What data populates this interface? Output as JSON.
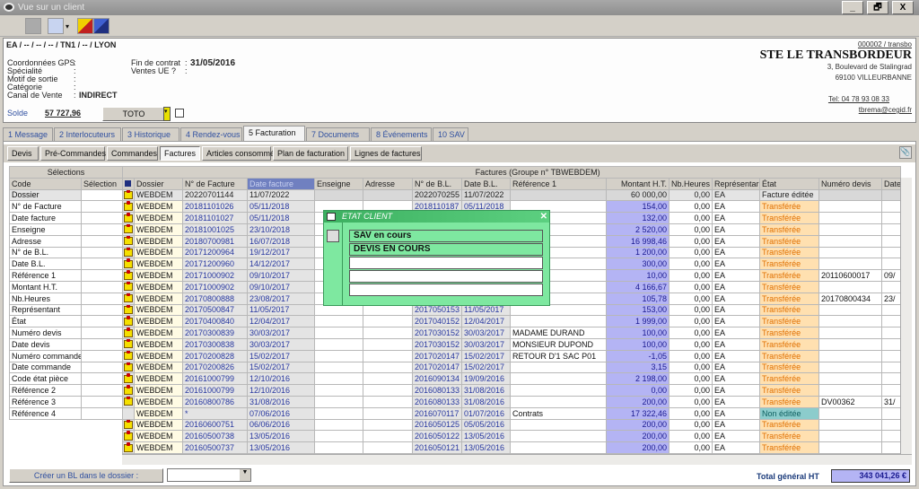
{
  "window": {
    "title": "Vue sur un client",
    "min": "_",
    "restore": "🗗",
    "close": "X"
  },
  "header": {
    "path": "EA / -- / -- / -- / TN1 / -- / LYON",
    "fields": [
      {
        "label": "Coordonnées GPS",
        "value": ""
      },
      {
        "label": "Spécialité",
        "value": ""
      },
      {
        "label": "Motif de sortie",
        "value": ""
      },
      {
        "label": "Catégorie",
        "value": ""
      },
      {
        "label": "Canal de Vente",
        "value": "INDIRECT"
      }
    ],
    "fields2": [
      {
        "label": "Fin de contrat",
        "value": "31/05/2016"
      },
      {
        "label": "Ventes UE ?",
        "value": ""
      }
    ],
    "solde_label": "Solde",
    "solde_value": "57 727,96",
    "combo_value": "TOTO",
    "company": {
      "code": "000002 / transbo",
      "name": "STE LE TRANSBORDEUR",
      "address1": "3, Boulevard de Stalingrad",
      "address2": "69100 VILLEURBANNE",
      "phone": "Tel: 04 78 93 08 33",
      "email": "tbrema@cegid.fr"
    }
  },
  "tabs": [
    "1 Message",
    "2 Interlocuteurs",
    "3 Historique",
    "4 Rendez-vous",
    "5 Facturation",
    "7 Documents",
    "8 Événements",
    "10 SAV"
  ],
  "active_tab": "5 Facturation",
  "subtabs": [
    "Devis",
    "Pré-Commandes",
    "Commandes",
    "Factures",
    "Articles consommés",
    "Plan de facturation",
    "Lignes de factures"
  ],
  "active_subtab": "Factures",
  "selections": {
    "title": "Sélections",
    "col_code": "Code",
    "col_selection": "Sélection",
    "codes": [
      "Dossier",
      "N° de Facture",
      "Date facture",
      "Enseigne",
      "Adresse",
      "N° de B.L.",
      "Date B.L.",
      "Référence 1",
      "Montant H.T.",
      "Nb.Heures",
      "Représentant",
      "État",
      "Numéro devis",
      "Date devis",
      "Numéro commande",
      "Date commande",
      "Code état pièce",
      "Référence 2",
      "Référence 3",
      "Référence 4"
    ]
  },
  "grid": {
    "title": "Factures   (Groupe n° TBWEBDEM)",
    "columns": [
      "Dossier",
      "N° de Facture",
      "Date facture",
      "Enseigne",
      "Adresse",
      "N° de B.L.",
      "Date B.L.",
      "Référence 1",
      "Montant H.T.",
      "Nb.Heures",
      "Représentar",
      "État",
      "Numéro devis",
      "Date"
    ],
    "rows": [
      [
        "WEBDEM",
        "20220701144",
        "11/07/2022",
        "",
        "",
        "2022070255",
        "11/07/2022",
        "",
        "60 000,00",
        "0,00",
        "EA",
        "Facture éditée",
        "",
        ""
      ],
      [
        "WEBDEM",
        "20181101026",
        "05/11/2018",
        "",
        "",
        "2018110187",
        "05/11/2018",
        "",
        "154,00",
        "0,00",
        "EA",
        "Transférée",
        "",
        ""
      ],
      [
        "WEBDEM",
        "20181101027",
        "05/11/2018",
        "",
        "",
        "",
        "",
        "",
        "132,00",
        "0,00",
        "EA",
        "Transférée",
        "",
        ""
      ],
      [
        "WEBDEM",
        "20181001025",
        "23/10/2018",
        "",
        "",
        "",
        "",
        "",
        "2 520,00",
        "0,00",
        "EA",
        "Transférée",
        "",
        ""
      ],
      [
        "WEBDEM",
        "20180700981",
        "16/07/2018",
        "",
        "",
        "",
        "",
        "",
        "16 998,46",
        "0,00",
        "EA",
        "Transférée",
        "",
        ""
      ],
      [
        "WEBDEM",
        "20171200964",
        "19/12/2017",
        "",
        "",
        "",
        "",
        "",
        "1 200,00",
        "0,00",
        "EA",
        "Transférée",
        "",
        ""
      ],
      [
        "WEBDEM",
        "20171200960",
        "14/12/2017",
        "",
        "",
        "",
        "",
        "",
        "300,00",
        "0,00",
        "EA",
        "Transférée",
        "",
        ""
      ],
      [
        "WEBDEM",
        "20171000902",
        "09/10/2017",
        "",
        "",
        "",
        "",
        "",
        "10,00",
        "0,00",
        "EA",
        "Transférée",
        "20110600017",
        "09/"
      ],
      [
        "WEBDEM",
        "20171000902",
        "09/10/2017",
        "",
        "",
        "",
        "",
        "",
        "4 166,67",
        "0,00",
        "EA",
        "Transférée",
        "",
        ""
      ],
      [
        "WEBDEM",
        "20170800888",
        "23/08/2017",
        "",
        "",
        "",
        "",
        "",
        "105,78",
        "0,00",
        "EA",
        "Transférée",
        "20170800434",
        "23/"
      ],
      [
        "WEBDEM",
        "20170500847",
        "11/05/2017",
        "",
        "",
        "2017050153",
        "11/05/2017",
        "",
        "153,00",
        "0,00",
        "EA",
        "Transférée",
        "",
        ""
      ],
      [
        "WEBDEM",
        "20170400840",
        "12/04/2017",
        "",
        "",
        "2017040152",
        "12/04/2017",
        "",
        "1 999,00",
        "0,00",
        "EA",
        "Transférée",
        "",
        ""
      ],
      [
        "WEBDEM",
        "20170300839",
        "30/03/2017",
        "",
        "",
        "2017030152",
        "30/03/2017",
        "MADAME DURAND",
        "100,00",
        "0,00",
        "EA",
        "Transférée",
        "",
        ""
      ],
      [
        "WEBDEM",
        "20170300838",
        "30/03/2017",
        "",
        "",
        "2017030152",
        "30/03/2017",
        "MONSIEUR DUPOND",
        "100,00",
        "0,00",
        "EA",
        "Transférée",
        "",
        ""
      ],
      [
        "WEBDEM",
        "20170200828",
        "15/02/2017",
        "",
        "",
        "2017020147",
        "15/02/2017",
        "RETOUR D'1 SAC P01",
        "-1,05",
        "0,00",
        "EA",
        "Transférée",
        "",
        ""
      ],
      [
        "WEBDEM",
        "20170200826",
        "15/02/2017",
        "",
        "",
        "2017020147",
        "15/02/2017",
        "",
        "3,15",
        "0,00",
        "EA",
        "Transférée",
        "",
        ""
      ],
      [
        "WEBDEM",
        "20161000799",
        "12/10/2016",
        "",
        "",
        "2016090134",
        "19/09/2016",
        "",
        "2 198,00",
        "0,00",
        "EA",
        "Transférée",
        "",
        ""
      ],
      [
        "WEBDEM",
        "20161000799",
        "12/10/2016",
        "",
        "",
        "2016080133",
        "31/08/2016",
        "",
        "0,00",
        "0,00",
        "EA",
        "Transférée",
        "",
        ""
      ],
      [
        "WEBDEM",
        "20160800786",
        "31/08/2016",
        "",
        "",
        "2016080133",
        "31/08/2016",
        "",
        "200,00",
        "0,00",
        "EA",
        "Transférée",
        "DV00362",
        "31/"
      ],
      [
        "WEBDEM",
        "*",
        "07/06/2016",
        "",
        "",
        "2016070117",
        "01/07/2016",
        "Contrats",
        "17 322,46",
        "0,00",
        "EA",
        "Non éditée",
        "",
        ""
      ],
      [
        "WEBDEM",
        "20160600751",
        "06/06/2016",
        "",
        "",
        "2016050125",
        "05/05/2016",
        "",
        "200,00",
        "0,00",
        "EA",
        "Transférée",
        "",
        ""
      ],
      [
        "WEBDEM",
        "20160500738",
        "13/05/2016",
        "",
        "",
        "2016050122",
        "13/05/2016",
        "",
        "200,00",
        "0,00",
        "EA",
        "Transférée",
        "",
        ""
      ],
      [
        "WEBDEM",
        "20160500737",
        "13/05/2016",
        "",
        "",
        "2016050121",
        "13/05/2016",
        "",
        "200,00",
        "0,00",
        "EA",
        "Transférée",
        "",
        ""
      ]
    ]
  },
  "popup": {
    "title": "ETAT CLIENT",
    "lines": [
      "SAV en cours",
      "DEVIS EN COURS",
      "",
      "",
      ""
    ]
  },
  "footer": {
    "create_bl_label": "Créer un BL dans le dossier :",
    "dossier_select": "",
    "total_label": "Total général  HT",
    "total_value": "343 041,26 €"
  }
}
